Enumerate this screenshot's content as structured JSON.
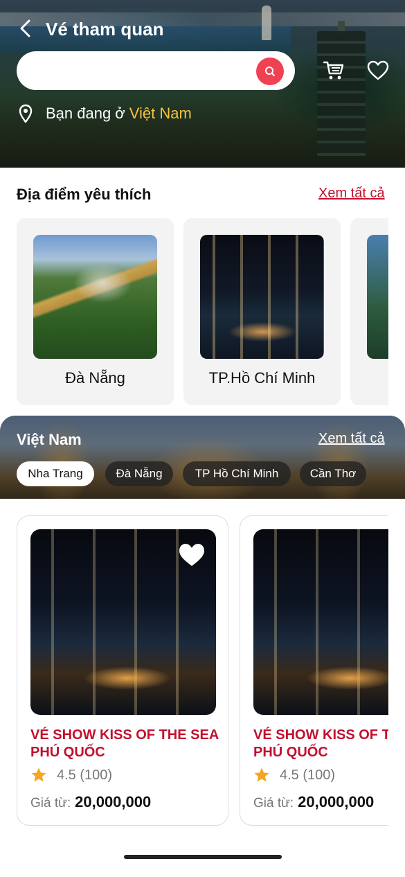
{
  "header": {
    "title": "Vé tham quan",
    "search_placeholder": "",
    "location_prefix": "Bạn đang ở",
    "location_country": "Việt Nam"
  },
  "favorites": {
    "title": "Địa điểm yêu thích",
    "see_all": "Xem tất cả",
    "items": [
      {
        "name": "Đà Nẵng"
      },
      {
        "name": "TP.Hồ Chí Minh"
      },
      {
        "name": ""
      }
    ]
  },
  "region": {
    "title": "Việt Nam",
    "see_all": "Xem tất cả",
    "chips": [
      {
        "label": "Nha Trang",
        "active": true
      },
      {
        "label": "Đà Nẵng",
        "active": false
      },
      {
        "label": "TP Hồ Chí Minh",
        "active": false
      },
      {
        "label": "Cần Thơ",
        "active": false
      }
    ]
  },
  "products": [
    {
      "name": "VÉ SHOW KISS OF THE SEA PHÚ QUỐC",
      "rating": "4.5 (100)",
      "price_label": "Giá từ:",
      "price": "20,000,000",
      "favorited": true
    },
    {
      "name": "VÉ SHOW KISS OF THE SEA PHÚ QUỐC",
      "rating": "4.5 (100)",
      "price_label": "Giá từ:",
      "price": "20,000,000",
      "favorited": false
    }
  ],
  "colors": {
    "accent": "#c2102e",
    "search_button": "#f04152",
    "highlight": "#f7c33a",
    "star": "#f5a623"
  },
  "icons": {
    "back": "chevron-left-icon",
    "search": "search-icon",
    "cart": "cart-icon",
    "favorite": "heart-icon",
    "location": "location-pin-icon",
    "rating": "star-icon"
  }
}
